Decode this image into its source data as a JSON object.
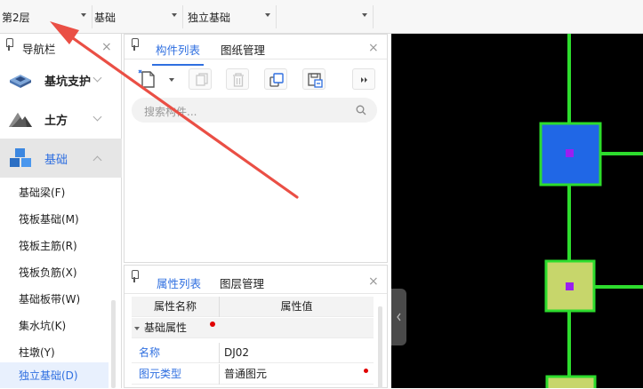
{
  "toolbar": {
    "floor": "第2层",
    "category": "基础",
    "component_type": "独立基础",
    "component_name": ""
  },
  "nav": {
    "title": "导航栏",
    "categories": [
      {
        "label": "基坑支护"
      },
      {
        "label": "土方"
      },
      {
        "label": "基础"
      }
    ],
    "items": [
      {
        "label": "基础梁(F)"
      },
      {
        "label": "筏板基础(M)"
      },
      {
        "label": "筏板主筋(R)"
      },
      {
        "label": "筏板负筋(X)"
      },
      {
        "label": "基础板带(W)"
      },
      {
        "label": "集水坑(K)"
      },
      {
        "label": "柱墩(Y)"
      },
      {
        "label": "独立基础(D)"
      }
    ]
  },
  "component_panel": {
    "tabs": [
      {
        "label": "构件列表"
      },
      {
        "label": "图纸管理"
      }
    ],
    "search_placeholder": "搜索构件..."
  },
  "property_panel": {
    "tabs": [
      {
        "label": "属性列表"
      },
      {
        "label": "图层管理"
      }
    ],
    "headers": {
      "name": "属性名称",
      "value": "属性值"
    },
    "group": "基础属性",
    "rows": [
      {
        "name": "名称",
        "value": "DJ02"
      },
      {
        "name": "图元类型",
        "value": "普通图元"
      }
    ]
  },
  "colors": {
    "accent": "#2f6fe0",
    "selected_bg": "#e8f0fd",
    "canvas_bg": "#000000",
    "axis_green": "#2ddc2d",
    "footing_blue": "#2067e6",
    "footing_olive": "#c7d66b",
    "marker_purple": "#9b1ff0",
    "annotation_arrow": "#ea4f45",
    "required_dot": "#e00000"
  }
}
